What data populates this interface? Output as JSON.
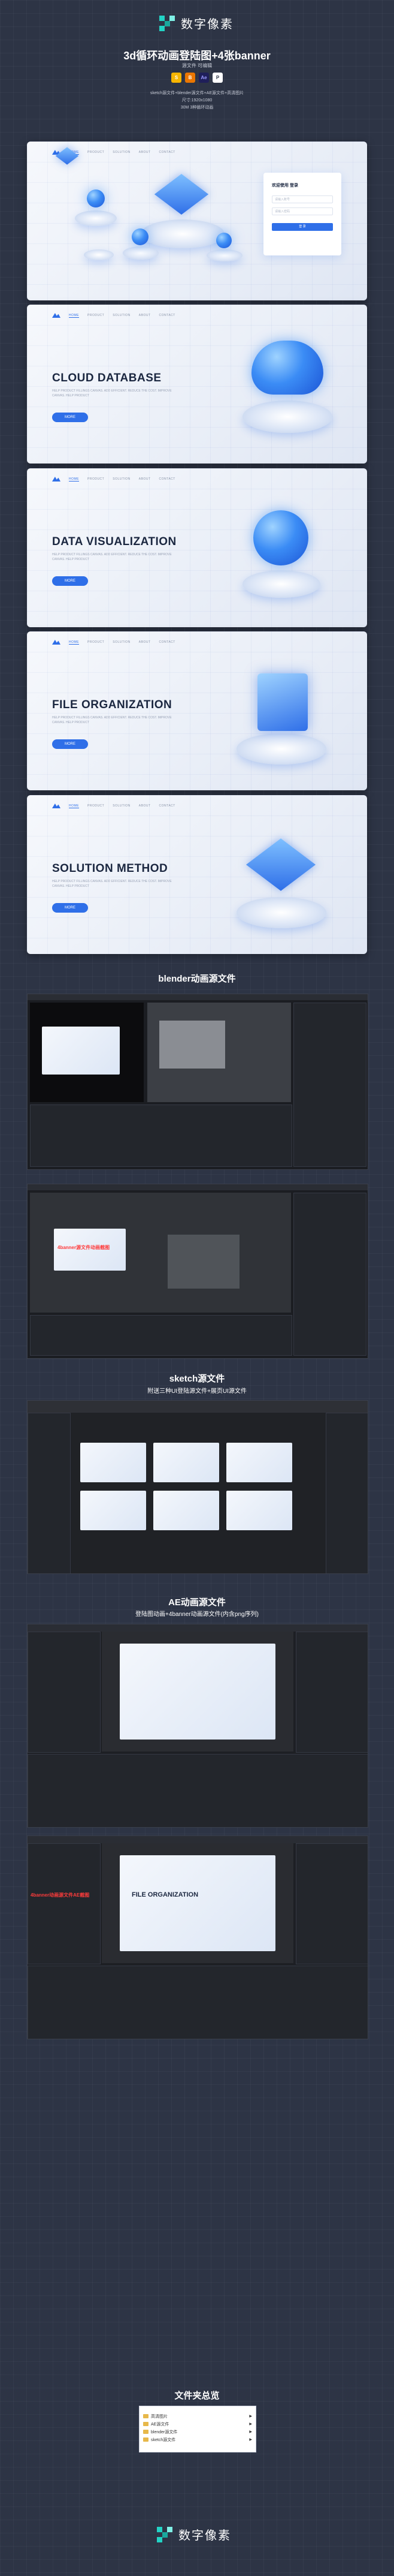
{
  "brand": {
    "name": "数字像素"
  },
  "header": {
    "title": "3d循环动画登陆图+4张banner",
    "subtitle": "源文件 可编辑",
    "badges": [
      {
        "icon": "sketch-icon",
        "color": "#f7b500",
        "label": "S"
      },
      {
        "icon": "blender-icon",
        "color": "#ea7600",
        "label": "B"
      },
      {
        "icon": "ae-icon",
        "color": "#1f1f5a",
        "label": "Ae"
      },
      {
        "icon": "png-icon",
        "color": "#ffffff",
        "label": "P"
      }
    ],
    "info_lines": [
      "sketch源文件+blender源文件+AE源文件+高清图片",
      "尺寸:1920x1080",
      "30M 3种循环动画"
    ]
  },
  "login_card": {
    "nav": [
      "HOME",
      "PRODUCT",
      "SOLUTION",
      "ABOUT",
      "CONTACT"
    ],
    "box_title": "欢迎使用 登录",
    "box_fields": [
      "请输入账号",
      "请输入密码"
    ],
    "box_button": "登 录"
  },
  "banners": [
    {
      "title": "CLOUD DATABASE",
      "desc": "HELP PRODUCT FILLINGS CANVAS. ADD EFFICIENT. REDUCE THE COST. IMPROVE CANVAS. HELP PRODUCT",
      "button": "MORE"
    },
    {
      "title": "DATA VISUALIZATION",
      "desc": "HELP PRODUCT FILLINGS CANVAS. ADD EFFICIENT. REDUCE THE COST. IMPROVE CANVAS. HELP PRODUCT",
      "button": "MORE"
    },
    {
      "title": "FILE ORGANIZATION",
      "desc": "HELP PRODUCT FILLINGS CANVAS. ADD EFFICIENT. REDUCE THE COST. IMPROVE CANVAS. HELP PRODUCT",
      "button": "MORE"
    },
    {
      "title": "SOLUTION METHOD",
      "desc": "HELP PRODUCT FILLINGS CANVAS. ADD EFFICIENT. REDUCE THE COST. IMPROVE CANVAS. HELP PRODUCT",
      "button": "MORE"
    }
  ],
  "sections": {
    "blender": {
      "title": "blender动画源文件"
    },
    "blender_shot2": {
      "note": "4banner源文件动画截图"
    },
    "sketch": {
      "title": "sketch源文件",
      "subtitle": "附送三种UI登陆源文件+展页UI源文件"
    },
    "ae": {
      "title": "AE动画源文件",
      "subtitle": "登陆图动画+4banner动画源文件(内含png序列)"
    },
    "ae_shot2": {
      "note": "4banner动画源文件AE截图",
      "banner_title": "FILE ORGANIZATION"
    },
    "folder": {
      "title": "文件夹总览",
      "items": [
        "高清图片",
        "AE源文件",
        "blender源文件",
        "sketch源文件"
      ]
    }
  },
  "footer": {
    "brand": "数字像素"
  },
  "colors": {
    "accent": "#2f6fe8",
    "brand": "#22d3c5",
    "background": "#2d3445"
  }
}
